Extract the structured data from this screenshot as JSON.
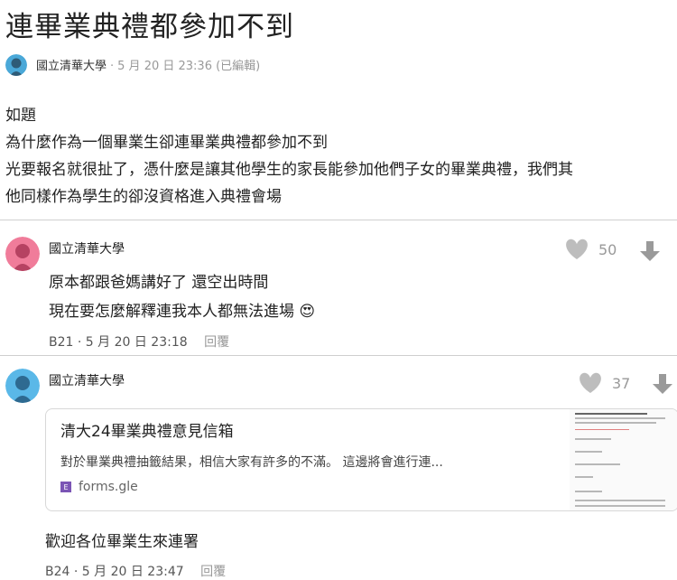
{
  "post": {
    "title": "連畢業典禮都參加不到",
    "author": "國立清華大學",
    "date": "5 月 20 日 23:36",
    "edited": "(已編輯)",
    "body": [
      "如題",
      "為什麼作為一個畢業生卻連畢業典禮都參加不到",
      "光要報名就很扯了，憑什麼是讓其他學生的家長能參加他們子女的畢業典禮，我們其",
      "他同樣作為學生的卻沒資格進入典禮會場"
    ]
  },
  "comments": [
    {
      "author": "國立清華大學",
      "lines": [
        "原本都跟爸媽講好了 還空出時間",
        "現在要怎麼解釋連我本人都無法進場"
      ],
      "emoji": "😍",
      "floor": "B21",
      "date": "5 月 20 日 23:18",
      "reply": "回覆",
      "likes": "50",
      "avatar_color": "#f07c9a"
    },
    {
      "author": "國立清華大學",
      "link_card": {
        "title": "清大24畢業典禮意見信箱",
        "description": "對於畢業典禮抽籤結果，相信大家有許多的不滿。 這邊將會進行連...",
        "site": "forms.gle",
        "favicon": "E"
      },
      "lines": [
        "歡迎各位畢業生來連署"
      ],
      "floor": "B24",
      "date": "5 月 20 日 23:47",
      "reply": "回覆",
      "likes": "37",
      "avatar_color": "#5ab8e8"
    }
  ],
  "colors": {
    "post_avatar": "#4aa8d8",
    "like_icon": "#bdbdbd",
    "down_icon": "#9a9a9a"
  },
  "icons": {
    "like": "heart-icon",
    "down": "arrow-down-icon"
  }
}
